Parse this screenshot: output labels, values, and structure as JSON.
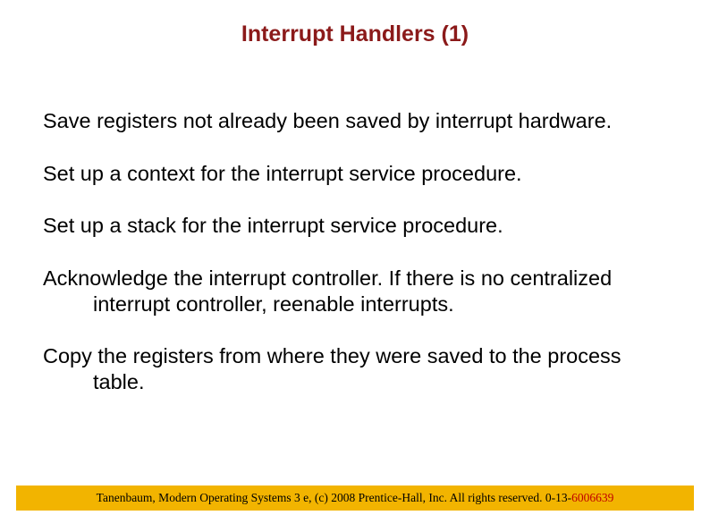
{
  "title": "Interrupt Handlers (1)",
  "items": [
    "Save registers not already been saved by interrupt hardware.",
    "Set up a context for the interrupt service procedure.",
    "Set up a stack for the interrupt service procedure.",
    "Acknowledge the interrupt controller. If there is no centralized interrupt controller, reenable interrupts.",
    "Copy the registers from where they were saved to the process table."
  ],
  "footer": {
    "prefix": "Tanenbaum, Modern Operating Systems 3 e, (c) 2008 Prentice-Hall, Inc. All rights reserved. 0-13-",
    "suffix": "6006639"
  }
}
